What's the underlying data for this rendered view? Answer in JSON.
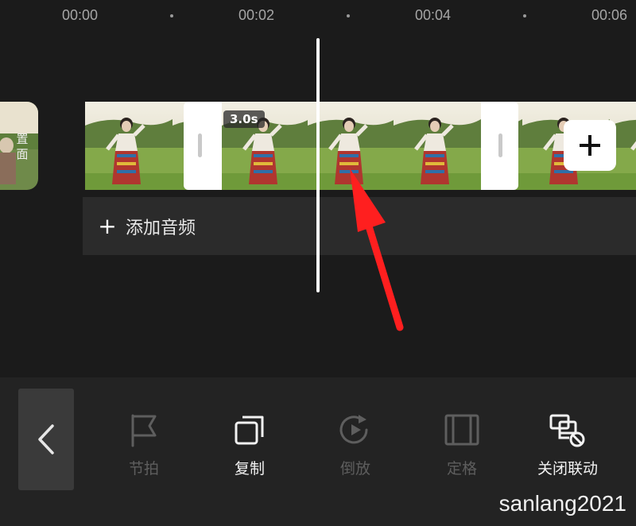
{
  "ruler": {
    "ticks": [
      "00:00",
      "00:02",
      "00:04",
      "00:06"
    ]
  },
  "cover": {
    "label": "置\n面"
  },
  "timeline": {
    "selected_clip_duration": "3.0s",
    "add_clip_icon": "plus-icon"
  },
  "audio": {
    "plus": "+",
    "label": "添加音频"
  },
  "toolbar": {
    "back_icon": "chevron-left-icon",
    "tools": [
      {
        "label": "节拍",
        "icon": "flag-icon",
        "enabled": false
      },
      {
        "label": "复制",
        "icon": "copy-icon",
        "enabled": true
      },
      {
        "label": "倒放",
        "icon": "reverse-play-icon",
        "enabled": false
      },
      {
        "label": "定格",
        "icon": "freeze-frame-icon",
        "enabled": false
      },
      {
        "label": "关闭联动",
        "icon": "unlink-icon",
        "enabled": true
      }
    ]
  },
  "watermark": "sanlang2021",
  "colors": {
    "background": "#1b1b1b",
    "toolbar": "#232323",
    "annotation_arrow": "#ff1f1f"
  }
}
